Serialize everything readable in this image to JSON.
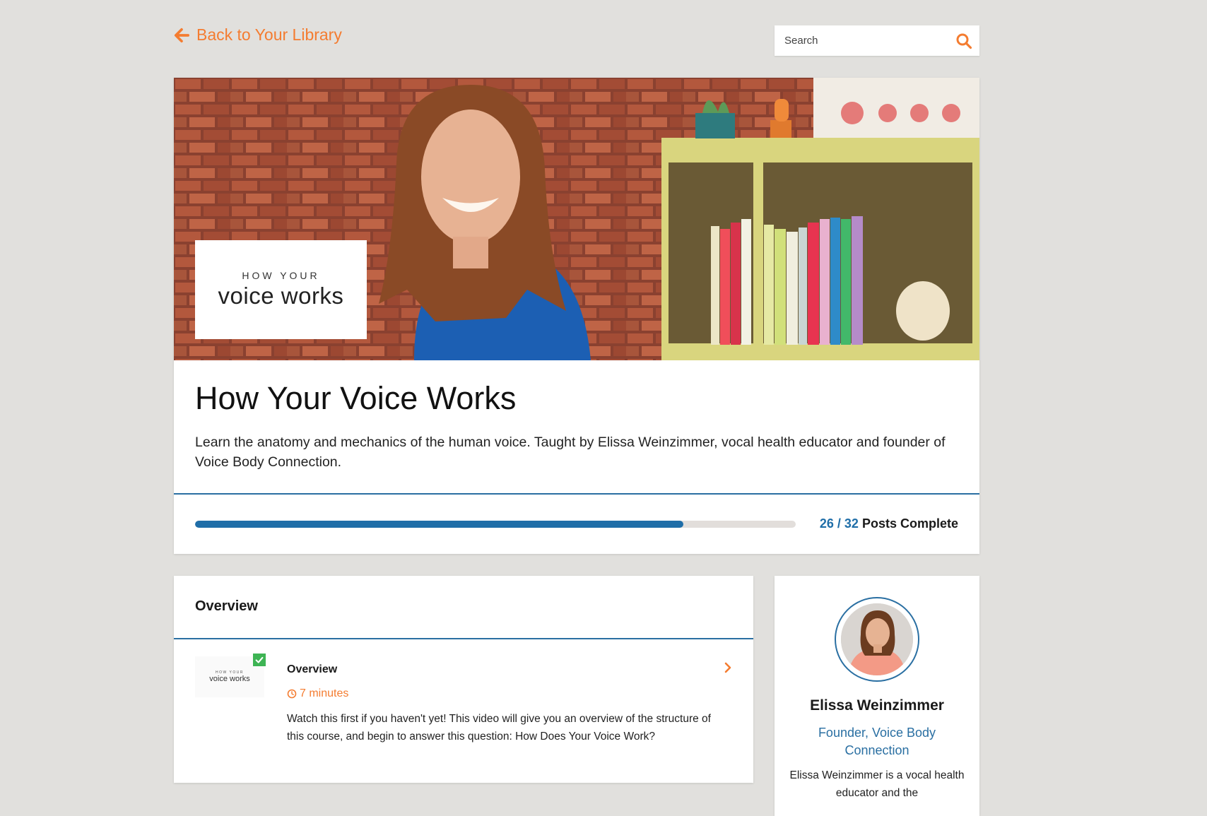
{
  "nav": {
    "back_label": "Back to Your Library",
    "back_icon": "arrow-left-icon"
  },
  "search": {
    "placeholder": "Search",
    "icon": "search-icon"
  },
  "course": {
    "logo_small": "HOW YOUR",
    "logo_big": "voice works",
    "title": "How Your Voice Works",
    "description": "Learn the anatomy and mechanics of the human voice. Taught by Elissa Weinzimmer, vocal health educator and founder of Voice Body Connection.",
    "progress": {
      "completed": "26",
      "separator": "/",
      "total": "32",
      "label": "Posts Complete",
      "fraction": 0.8125
    }
  },
  "module": {
    "title": "Overview",
    "posts": [
      {
        "thumb_small": "HOW YOUR",
        "thumb_big": "voice works",
        "title": "Overview",
        "duration": "7 minutes",
        "description": "Watch this first if you haven't yet! This video will give you an overview of the structure of this course, and begin to answer this question: How Does Your Voice Work?",
        "completed": true
      }
    ]
  },
  "author": {
    "name": "Elissa Weinzimmer",
    "role": "Founder, Voice Body Connection",
    "bio": "Elissa Weinzimmer is a vocal health educator and the"
  },
  "colors": {
    "accent": "#f47c30",
    "primary": "#1f6ea8",
    "background": "#e1e0dd",
    "check": "#3eb454"
  }
}
